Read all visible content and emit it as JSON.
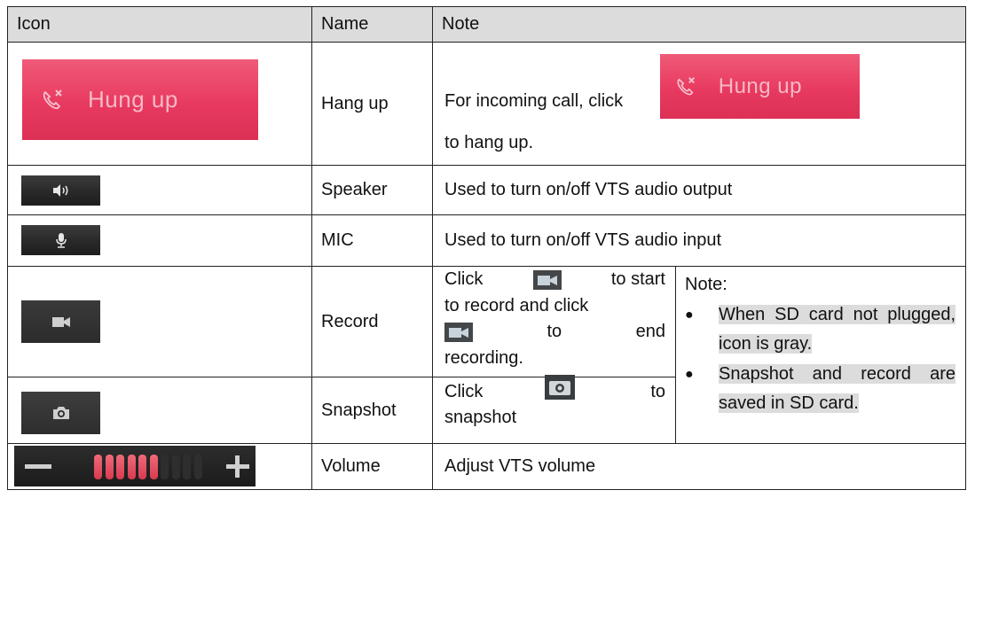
{
  "headers": {
    "icon": "Icon",
    "name": "Name",
    "note": "Note"
  },
  "rows": {
    "hangup": {
      "icon_label": "Hung up",
      "name": "Hang up",
      "note_before": "For incoming call, click",
      "note_after": "to hang up."
    },
    "speaker": {
      "name": "Speaker",
      "note": "Used to turn on/off VTS audio output"
    },
    "mic": {
      "name": "MIC",
      "note": "Used to turn on/off VTS audio input"
    },
    "record": {
      "name": "Record",
      "note_part1": "Click",
      "note_part2": "to start",
      "note_part3": "to record and click",
      "note_part4": "to",
      "note_part5": "end",
      "note_part6": "recording."
    },
    "snapshot": {
      "name": "Snapshot",
      "note_part1": "Click",
      "note_part2": "to",
      "note_part3": "snapshot"
    },
    "volume": {
      "name": "Volume",
      "note": "Adjust VTS volume",
      "level_filled": 6,
      "level_total": 10
    }
  },
  "side_note": {
    "title": "Note:",
    "bullet1": "When SD card not plugged, icon is gray.",
    "bullet2": "Snapshot and record are saved in SD card."
  },
  "colors": {
    "hangup_bg": "#e83a60",
    "header_bg": "#dcdcdc",
    "volume_active": "#d83a4f",
    "volume_inactive": "#2e2e2e"
  },
  "icons": [
    "phone-hangup-icon",
    "speaker-icon",
    "microphone-icon",
    "video-camera-icon",
    "camera-icon",
    "minus-icon",
    "plus-icon"
  ]
}
